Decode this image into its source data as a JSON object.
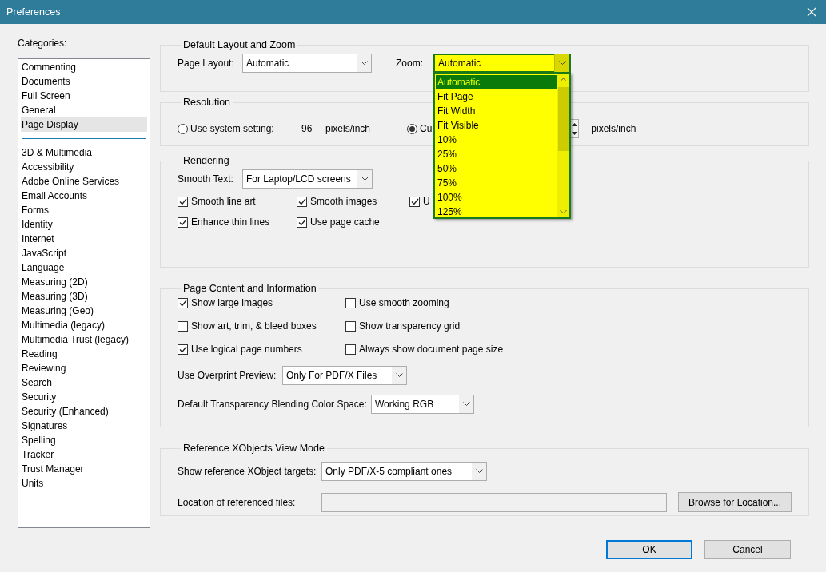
{
  "window": {
    "title": "Preferences"
  },
  "categories": {
    "label": "Categories:",
    "groups": [
      [
        {
          "label": "Commenting",
          "selected": false
        },
        {
          "label": "Documents",
          "selected": false
        },
        {
          "label": "Full Screen",
          "selected": false
        },
        {
          "label": "General",
          "selected": false
        },
        {
          "label": "Page Display",
          "selected": true
        }
      ],
      [
        {
          "label": "3D & Multimedia",
          "selected": false
        },
        {
          "label": "Accessibility",
          "selected": false
        },
        {
          "label": "Adobe Online Services",
          "selected": false
        },
        {
          "label": "Email Accounts",
          "selected": false
        },
        {
          "label": "Forms",
          "selected": false
        },
        {
          "label": "Identity",
          "selected": false
        },
        {
          "label": "Internet",
          "selected": false
        },
        {
          "label": "JavaScript",
          "selected": false
        },
        {
          "label": "Language",
          "selected": false
        },
        {
          "label": "Measuring (2D)",
          "selected": false
        },
        {
          "label": "Measuring (3D)",
          "selected": false
        },
        {
          "label": "Measuring (Geo)",
          "selected": false
        },
        {
          "label": "Multimedia (legacy)",
          "selected": false
        },
        {
          "label": "Multimedia Trust (legacy)",
          "selected": false
        },
        {
          "label": "Reading",
          "selected": false
        },
        {
          "label": "Reviewing",
          "selected": false
        },
        {
          "label": "Search",
          "selected": false
        },
        {
          "label": "Security",
          "selected": false
        },
        {
          "label": "Security (Enhanced)",
          "selected": false
        },
        {
          "label": "Signatures",
          "selected": false
        },
        {
          "label": "Spelling",
          "selected": false
        },
        {
          "label": "Tracker",
          "selected": false
        },
        {
          "label": "Trust Manager",
          "selected": false
        },
        {
          "label": "Units",
          "selected": false
        }
      ]
    ]
  },
  "layout_zoom": {
    "title": "Default Layout and Zoom",
    "page_layout": {
      "label": "Page Layout:",
      "value": "Automatic"
    },
    "zoom": {
      "label": "Zoom:",
      "value": "Automatic",
      "expanded": true,
      "options": [
        {
          "label": "Automatic",
          "selected": true
        },
        {
          "label": "Fit Page",
          "selected": false
        },
        {
          "label": "Fit Width",
          "selected": false
        },
        {
          "label": "Fit Visible",
          "selected": false
        },
        {
          "label": "10%",
          "selected": false
        },
        {
          "label": "25%",
          "selected": false
        },
        {
          "label": "50%",
          "selected": false
        },
        {
          "label": "75%",
          "selected": false
        },
        {
          "label": "100%",
          "selected": false
        },
        {
          "label": "125%",
          "selected": false
        }
      ]
    }
  },
  "resolution": {
    "title": "Resolution",
    "options": [
      {
        "label": "Use system setting:",
        "selected": false,
        "value": "96",
        "unit": "pixels/inch"
      },
      {
        "label": "Cu",
        "selected": true,
        "unit": "pixels/inch"
      }
    ]
  },
  "rendering": {
    "title": "Rendering",
    "smooth_text": {
      "label": "Smooth Text:",
      "value": "For Laptop/LCD screens"
    },
    "checkboxes": [
      {
        "label": "Smooth line art",
        "checked": true
      },
      {
        "label": "Smooth images",
        "checked": true
      },
      {
        "label": "U",
        "checked": true
      },
      {
        "label": "Enhance thin lines",
        "checked": true
      },
      {
        "label": "Use page cache",
        "checked": true
      }
    ]
  },
  "page_content": {
    "title": "Page Content and Information",
    "checkboxes": [
      {
        "label": "Show large images",
        "checked": true
      },
      {
        "label": "Use smooth zooming",
        "checked": false
      },
      {
        "label": "Show art, trim, & bleed boxes",
        "checked": false
      },
      {
        "label": "Show transparency grid",
        "checked": false
      },
      {
        "label": "Use logical page numbers",
        "checked": true
      },
      {
        "label": "Always show document page size",
        "checked": false
      }
    ],
    "overprint": {
      "label": "Use Overprint Preview:",
      "value": "Only For PDF/X Files"
    },
    "blending": {
      "label": "Default Transparency Blending Color Space:",
      "value": "Working RGB"
    }
  },
  "reference": {
    "title": "Reference XObjects View Mode",
    "targets": {
      "label": "Show reference XObject targets:",
      "value": "Only PDF/X-5 compliant ones"
    },
    "location": {
      "label": "Location of referenced files:",
      "button": "Browse for Location..."
    }
  },
  "buttons": [
    {
      "label": "OK",
      "default": true
    },
    {
      "label": "Cancel",
      "default": false
    }
  ]
}
